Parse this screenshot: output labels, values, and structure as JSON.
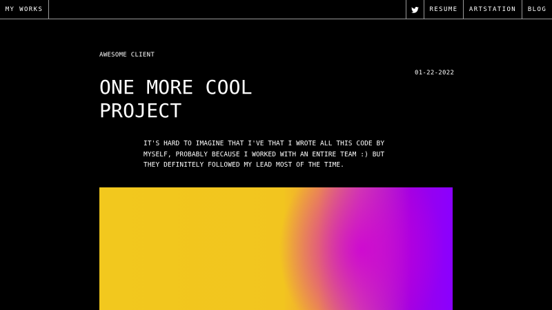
{
  "nav": {
    "works_label": "MY WORKS",
    "twitter_icon": "twitter-icon",
    "resume_label": "RESUME",
    "artstation_label": "ARTSTATION",
    "blog_label": "BLOG"
  },
  "project": {
    "client": "AWESOME CLIENT",
    "date": "01-22-2022",
    "title": "ONE MORE COOL PROJECT",
    "description": "IT'S HARD TO IMAGINE THAT I'VE THAT I WROTE ALL THIS CODE BY MYSELF, PROBABLY BECAUSE I WORKED WITH AN ENTIRE TEAM :) BUT THEY DEFINITELY FOLLOWED MY LEAD MOST OF THE TIME."
  },
  "colors": {
    "background": "#000000",
    "text": "#ffffff",
    "divider": "#9a9a9a",
    "gradient_start": "#f2c81e",
    "gradient_mid": "#d24aa6",
    "gradient_end": "#8a00ff"
  }
}
